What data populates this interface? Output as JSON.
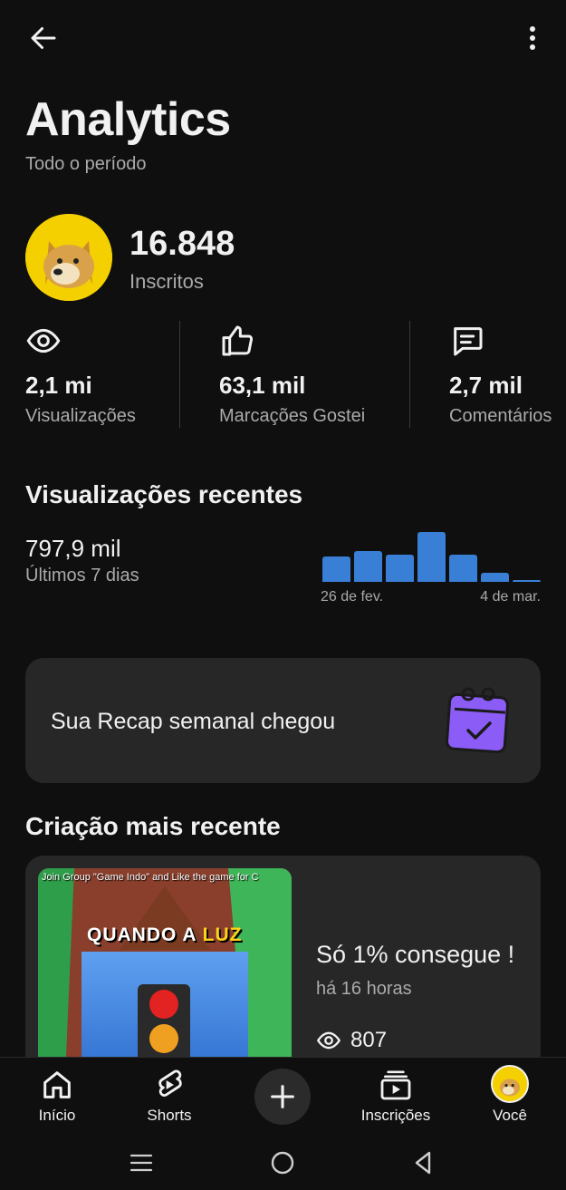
{
  "header": {
    "title": "Analytics",
    "subtitle": "Todo o período"
  },
  "channel": {
    "subscribers": "16.848",
    "subscribers_label": "Inscritos"
  },
  "stats": [
    {
      "icon": "eye-icon",
      "value": "2,1 mi",
      "label": "Visualizações"
    },
    {
      "icon": "thumbs-up-icon",
      "value": "63,1 mil",
      "label": "Marcações Gostei"
    },
    {
      "icon": "comment-icon",
      "value": "2,7 mil",
      "label": "Comentários"
    }
  ],
  "recent_views": {
    "title": "Visualizações recentes",
    "value": "797,9 mil",
    "period": "Últimos 7 dias",
    "axis_start": "26 de fev.",
    "axis_end": "4 de mar."
  },
  "chart_data": {
    "type": "bar",
    "values": [
      0.48,
      0.58,
      0.52,
      0.95,
      0.52,
      0.17,
      0.04
    ],
    "color": "#3a7fd6"
  },
  "recap": {
    "text": "Sua Recap semanal chegou",
    "icon": "calendar-check-icon",
    "color": "#8b5cf6"
  },
  "latest": {
    "title": "Criação mais recente",
    "video_title": "Só 1% consegue !",
    "age": "há 16 horas",
    "views": "807",
    "thumb_banner": "Join Group \"Game Indo\" and Like the game for C",
    "thumb_caption_a": "QUANDO A",
    "thumb_caption_b": "LUZ"
  },
  "nav": {
    "home": "Início",
    "shorts": "Shorts",
    "subscriptions": "Inscrições",
    "you": "Você"
  }
}
